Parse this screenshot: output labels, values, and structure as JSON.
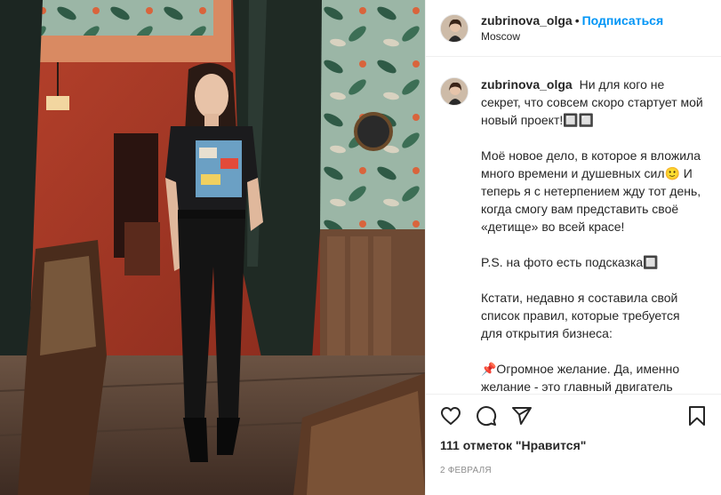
{
  "post": {
    "username": "zubrinova_olga",
    "separator": "•",
    "follow_label": "Подписаться",
    "location": "Moscow"
  },
  "caption": {
    "paragraphs": [
      "Ни для кого не секрет, что совсем скоро стартует мой новый проект!🔲🔲",
      "Моё новое дело, в которое я вложила много времени и душевных сил🙂 И теперь я с нетерпением жду тот день, когда смогу вам представить своё «детище» во всей красе!",
      "P.S. на фото есть подсказка🔲",
      "Кстати, недавно я составила свой список правил, которые требуется для открытия бизнеса:",
      "📌Огромное желание. Да, именно желание - это главный двигатель всего процесса. Не зря говорят, если"
    ]
  },
  "actions": {
    "like_icon": "heart-icon",
    "comment_icon": "comment-icon",
    "share_icon": "share-icon",
    "save_icon": "bookmark-icon"
  },
  "likes_text": "111 отметок \"Нравится\"",
  "date_text": "2 февраля",
  "photo": {
    "icon": "photo-restaurant-woman",
    "colors": {
      "wall_red": "#c8402a",
      "curtain": "#1f2a24",
      "wallpaper": "#8fb0a0",
      "floor": "#5a4436"
    }
  }
}
